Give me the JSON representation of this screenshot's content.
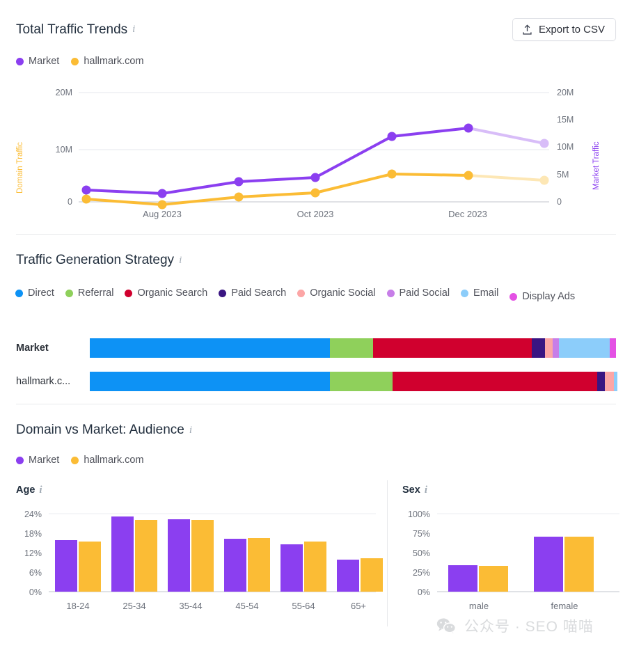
{
  "header": {
    "title": "Total Traffic Trends",
    "info_icon": "info-icon",
    "export_label": "Export to CSV",
    "export_icon": "upload-icon"
  },
  "trend_legend": [
    {
      "label": "Market",
      "color": "#8b3ff0"
    },
    {
      "label": "hallmark.com",
      "color": "#fbbc35"
    }
  ],
  "traffic_strategy": {
    "title": "Traffic Generation Strategy",
    "legend": [
      {
        "label": "Direct",
        "color": "#0d92f5"
      },
      {
        "label": "Referral",
        "color": "#8fd05b"
      },
      {
        "label": "Organic Search",
        "color": "#d0002e"
      },
      {
        "label": "Paid Search",
        "color": "#3a1582"
      },
      {
        "label": "Organic Social",
        "color": "#fca6a6"
      },
      {
        "label": "Paid Social",
        "color": "#c77ee8"
      },
      {
        "label": "Email",
        "color": "#8ccdfa"
      },
      {
        "label": "Display Ads",
        "color": "#e451e4"
      }
    ],
    "rows": [
      {
        "label": "Market",
        "values": [
          45.3,
          8.2,
          30.1,
          2.5,
          1.5,
          1.2,
          9.8,
          1.4
        ]
      },
      {
        "label": "hallmark.c...",
        "values": [
          45.3,
          11.8,
          38.8,
          1.5,
          1.9,
          0.0,
          0.7,
          0.0
        ]
      }
    ]
  },
  "audience": {
    "title": "Domain vs Market: Audience",
    "legend": [
      {
        "label": "Market",
        "color": "#8b3ff0"
      },
      {
        "label": "hallmark.com",
        "color": "#fbbc35"
      }
    ],
    "age_title": "Age",
    "sex_title": "Sex"
  },
  "watermark": {
    "text": "公众号 · SEO 喵喵",
    "icon": "wechat-icon"
  },
  "chart_data": [
    {
      "type": "line",
      "title": "Total Traffic Trends",
      "xlabel": "",
      "ylabel": "Domain Traffic",
      "y2label": "Market Traffic",
      "x": [
        "Jul 2023",
        "Aug 2023",
        "Sep 2023",
        "Oct 2023",
        "Nov 2023",
        "Dec 2023",
        "Jan 2024"
      ],
      "tick_labels": [
        "Aug 2023",
        "Oct 2023",
        "Dec 2023"
      ],
      "ylim": [
        0,
        20000000
      ],
      "yticks": [
        "0",
        "10M",
        "20M"
      ],
      "y2lim": [
        0,
        20000000
      ],
      "y2ticks": [
        "0",
        "5M",
        "10M",
        "15M",
        "20M"
      ],
      "grid": true,
      "legend_position": "top-left",
      "series": [
        {
          "name": "Market",
          "color": "#8b3ff0",
          "values": [
            4700000,
            4100000,
            5900000,
            6500000,
            11600000,
            13100000,
            10400000
          ],
          "faded_from_index": 5
        },
        {
          "name": "hallmark.com",
          "color": "#fbbc35",
          "values": [
            3000000,
            2000000,
            3300000,
            4000000,
            7100000,
            6900000,
            6000000
          ],
          "faded_from_index": 5
        }
      ]
    },
    {
      "type": "bar",
      "title": "Traffic Generation Strategy",
      "stacked": true,
      "orientation": "horizontal",
      "categories": [
        "Market",
        "hallmark.c..."
      ],
      "series": [
        {
          "name": "Direct",
          "color": "#0d92f5",
          "values": [
            45.3,
            45.3
          ]
        },
        {
          "name": "Referral",
          "color": "#8fd05b",
          "values": [
            8.2,
            11.8
          ]
        },
        {
          "name": "Organic Search",
          "color": "#d0002e",
          "values": [
            30.1,
            38.8
          ]
        },
        {
          "name": "Paid Search",
          "color": "#3a1582",
          "values": [
            2.5,
            1.5
          ]
        },
        {
          "name": "Organic Social",
          "color": "#fca6a6",
          "values": [
            1.5,
            1.9
          ]
        },
        {
          "name": "Paid Social",
          "color": "#c77ee8",
          "values": [
            1.2,
            0.0
          ]
        },
        {
          "name": "Email",
          "color": "#8ccdfa",
          "values": [
            9.8,
            0.7
          ]
        },
        {
          "name": "Display Ads",
          "color": "#e451e4",
          "values": [
            1.4,
            0.0
          ]
        }
      ]
    },
    {
      "type": "bar",
      "title": "Age",
      "categories": [
        "18-24",
        "25-34",
        "35-44",
        "45-54",
        "55-64",
        "65+"
      ],
      "ylabel": "",
      "ylim": [
        0,
        24
      ],
      "yticks": [
        "0%",
        "6%",
        "12%",
        "18%",
        "24%"
      ],
      "grid": true,
      "series": [
        {
          "name": "Market",
          "color": "#8b3ff0",
          "values": [
            15.8,
            23.2,
            22.3,
            16.2,
            14.5,
            9.8
          ]
        },
        {
          "name": "hallmark.com",
          "color": "#fbbc35",
          "values": [
            15.4,
            22.1,
            22.1,
            16.5,
            15.4,
            10.3
          ]
        }
      ]
    },
    {
      "type": "bar",
      "title": "Sex",
      "categories": [
        "male",
        "female"
      ],
      "ylabel": "",
      "ylim": [
        0,
        100
      ],
      "yticks": [
        "0%",
        "25%",
        "50%",
        "75%",
        "100%"
      ],
      "grid": true,
      "series": [
        {
          "name": "Market",
          "color": "#8b3ff0",
          "values": [
            34,
            66
          ]
        },
        {
          "name": "hallmark.com",
          "color": "#fbbc35",
          "values": [
            33,
            66
          ]
        }
      ]
    }
  ]
}
